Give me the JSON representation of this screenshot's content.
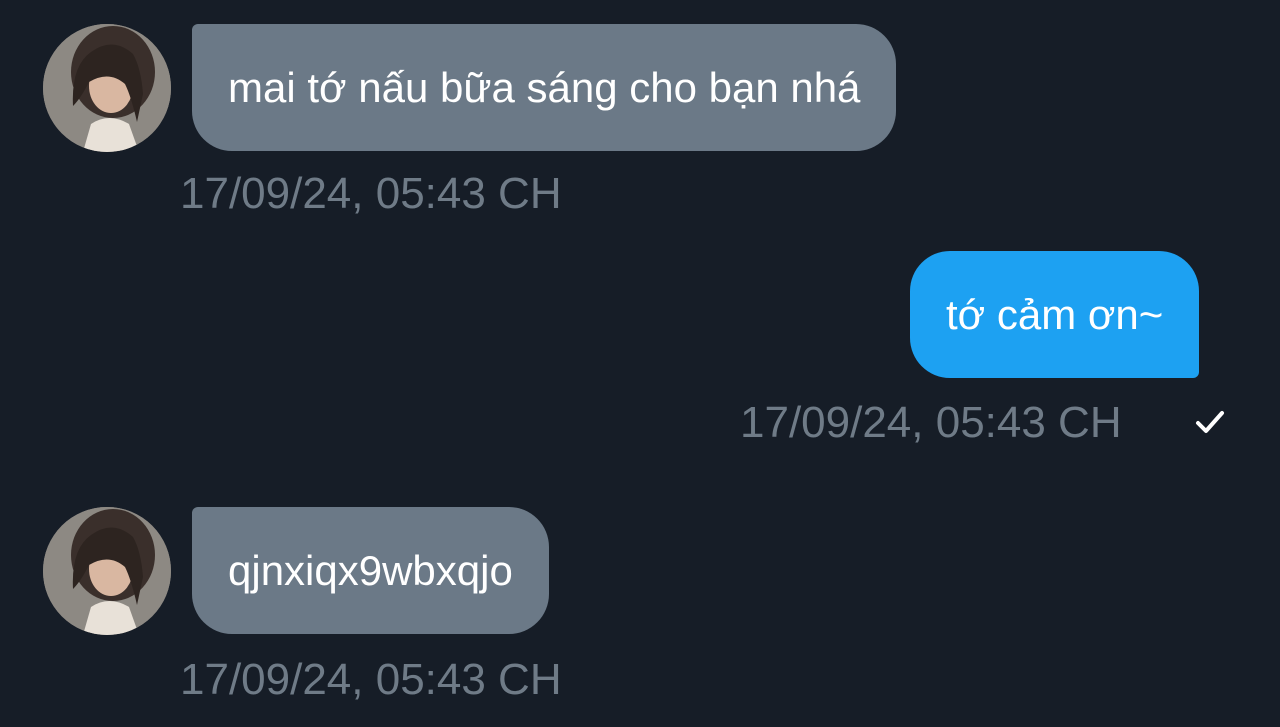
{
  "messages": [
    {
      "direction": "incoming",
      "text": "mai tớ nấu bữa sáng cho bạn nhá",
      "timestamp": "17/09/24, 05:43 CH"
    },
    {
      "direction": "outgoing",
      "text": "tớ cảm ơn~",
      "timestamp": "17/09/24, 05:43 CH",
      "status_icon": "single-check-icon"
    },
    {
      "direction": "incoming",
      "text": "qjnxiqx9wbxqjo",
      "timestamp": "17/09/24, 05:43 CH"
    }
  ],
  "colors": {
    "background": "#161d27",
    "incoming_bubble": "#6b7987",
    "outgoing_bubble": "#1da1f2",
    "timestamp": "#6f7b87",
    "text": "#ffffff"
  }
}
